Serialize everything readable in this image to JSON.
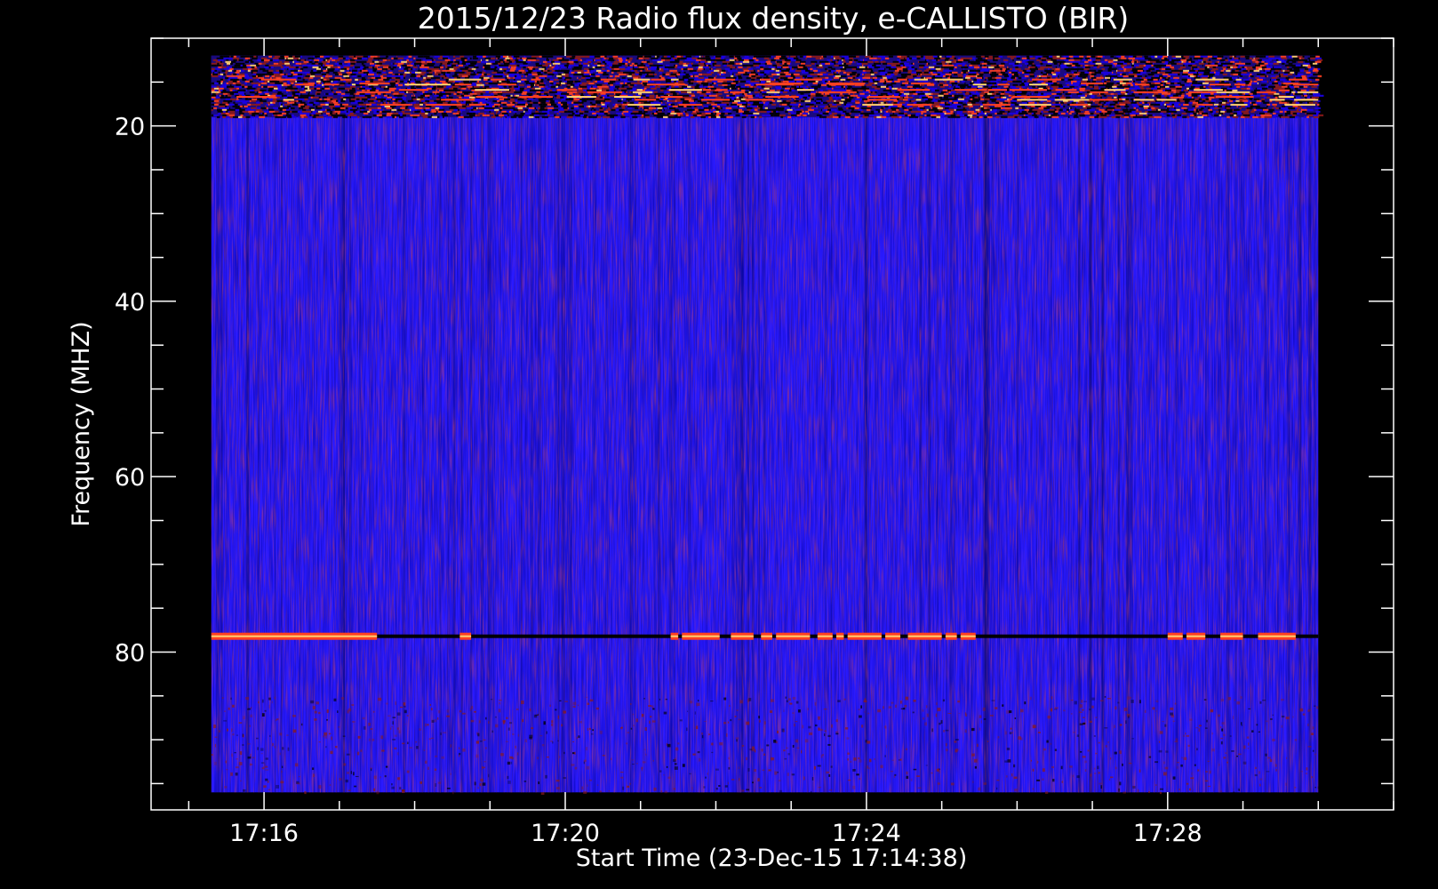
{
  "chart_data": {
    "type": "heatmap",
    "title": "2015/12/23  Radio flux density, e-CALLISTO (BIR)",
    "xlabel": "Start Time (23-Dec-15 17:14:38)",
    "ylabel": "Frequency (MHZ)",
    "x_range_minutes": [
      14.5,
      31.0
    ],
    "data_x_range_minutes": [
      15.3,
      30.0
    ],
    "y_range_mhz": [
      10.0,
      98.0
    ],
    "data_y_range_mhz": [
      12.0,
      96.0
    ],
    "y_reversed": true,
    "x_ticks_minutes": [
      16,
      20,
      24,
      28
    ],
    "x_tick_labels": [
      "17:16",
      "17:20",
      "17:24",
      "17:28"
    ],
    "x_minor_tick_step_minutes": 1,
    "y_ticks_mhz": [
      20,
      40,
      60,
      80
    ],
    "y_tick_labels": [
      "20",
      "40",
      "60",
      "80"
    ],
    "y_minor_tick_step_mhz": 5,
    "colormap": [
      "#000000",
      "#1a00e6",
      "#2a1aff",
      "#8b1a1a",
      "#ff4020",
      "#ffd070",
      "#ffffff"
    ],
    "background_color": "#2a1aff",
    "interference_band_mhz": [
      12.0,
      19.0
    ],
    "rfi_line": {
      "freq_mhz": 78.2,
      "segments_minutes": [
        [
          15.3,
          17.5
        ],
        [
          18.6,
          18.75
        ],
        [
          21.4,
          21.5
        ],
        [
          21.55,
          22.05
        ],
        [
          22.2,
          22.5
        ],
        [
          22.6,
          22.75
        ],
        [
          22.8,
          23.25
        ],
        [
          23.35,
          23.55
        ],
        [
          23.6,
          23.7
        ],
        [
          23.75,
          24.2
        ],
        [
          24.25,
          24.45
        ],
        [
          24.55,
          25.0
        ],
        [
          25.05,
          25.2
        ],
        [
          25.25,
          25.45
        ],
        [
          28.0,
          28.2
        ],
        [
          28.25,
          28.5
        ],
        [
          28.7,
          29.0
        ],
        [
          29.2,
          29.7
        ]
      ]
    },
    "weak_band_mhz": [
      85.0,
      96.0
    ]
  }
}
